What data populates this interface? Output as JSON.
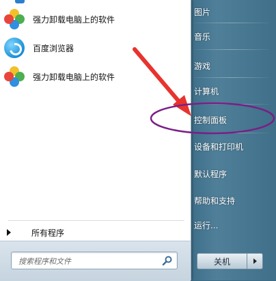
{
  "left_programs": [
    {
      "label": "强力卸载电脑上的软件",
      "icon": "pinwheel-icon"
    },
    {
      "label": "百度浏览器",
      "icon": "baidu-browser-icon"
    },
    {
      "label": "强力卸载电脑上的软件",
      "icon": "pinwheel-icon"
    }
  ],
  "all_programs": {
    "label": "所有程序"
  },
  "search": {
    "placeholder": "搜索程序和文件",
    "value": ""
  },
  "right_items": [
    {
      "label": "图片"
    },
    {
      "label": "音乐"
    },
    {
      "label": "游戏"
    },
    {
      "label": "计算机"
    },
    {
      "label": "控制面板"
    },
    {
      "label": "设备和打印机"
    },
    {
      "label": "默认程序"
    },
    {
      "label": "帮助和支持"
    },
    {
      "label": "运行..."
    }
  ],
  "shutdown": {
    "label": "关机"
  },
  "colors": {
    "annotation_arrow": "#e8332e",
    "annotation_ellipse": "#7a1f86",
    "right_pane": "#3f6f89"
  }
}
